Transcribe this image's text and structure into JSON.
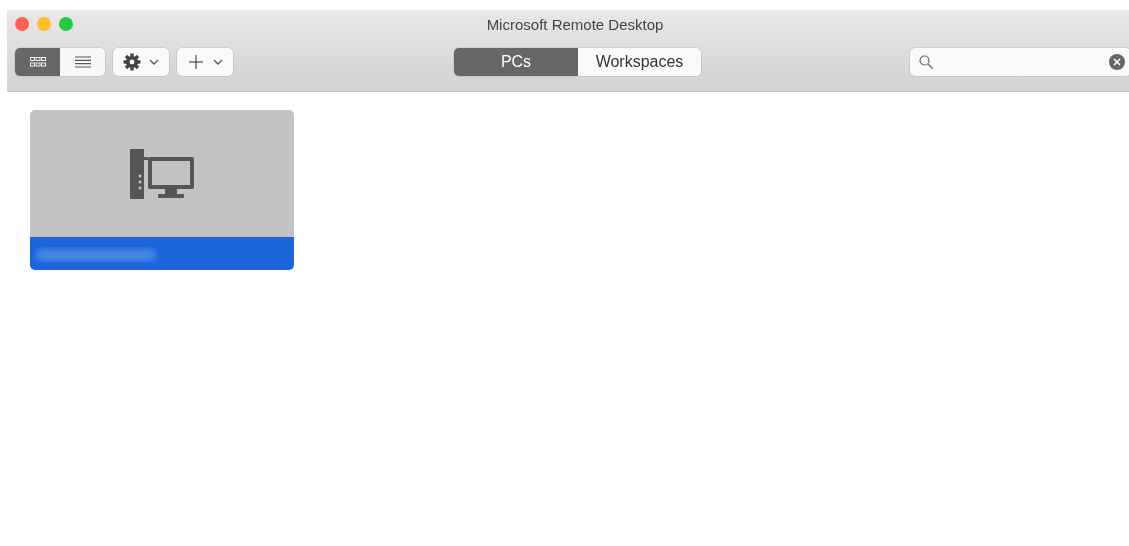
{
  "window": {
    "title": "Microsoft Remote Desktop"
  },
  "view_toggle": [
    {
      "kind": "grid",
      "selected": true
    },
    {
      "kind": "list",
      "selected": false
    }
  ],
  "tabs": [
    {
      "label": "PCs",
      "selected": true
    },
    {
      "label": "Workspaces",
      "selected": false
    }
  ],
  "pcs": [
    {
      "selected": true
    }
  ]
}
